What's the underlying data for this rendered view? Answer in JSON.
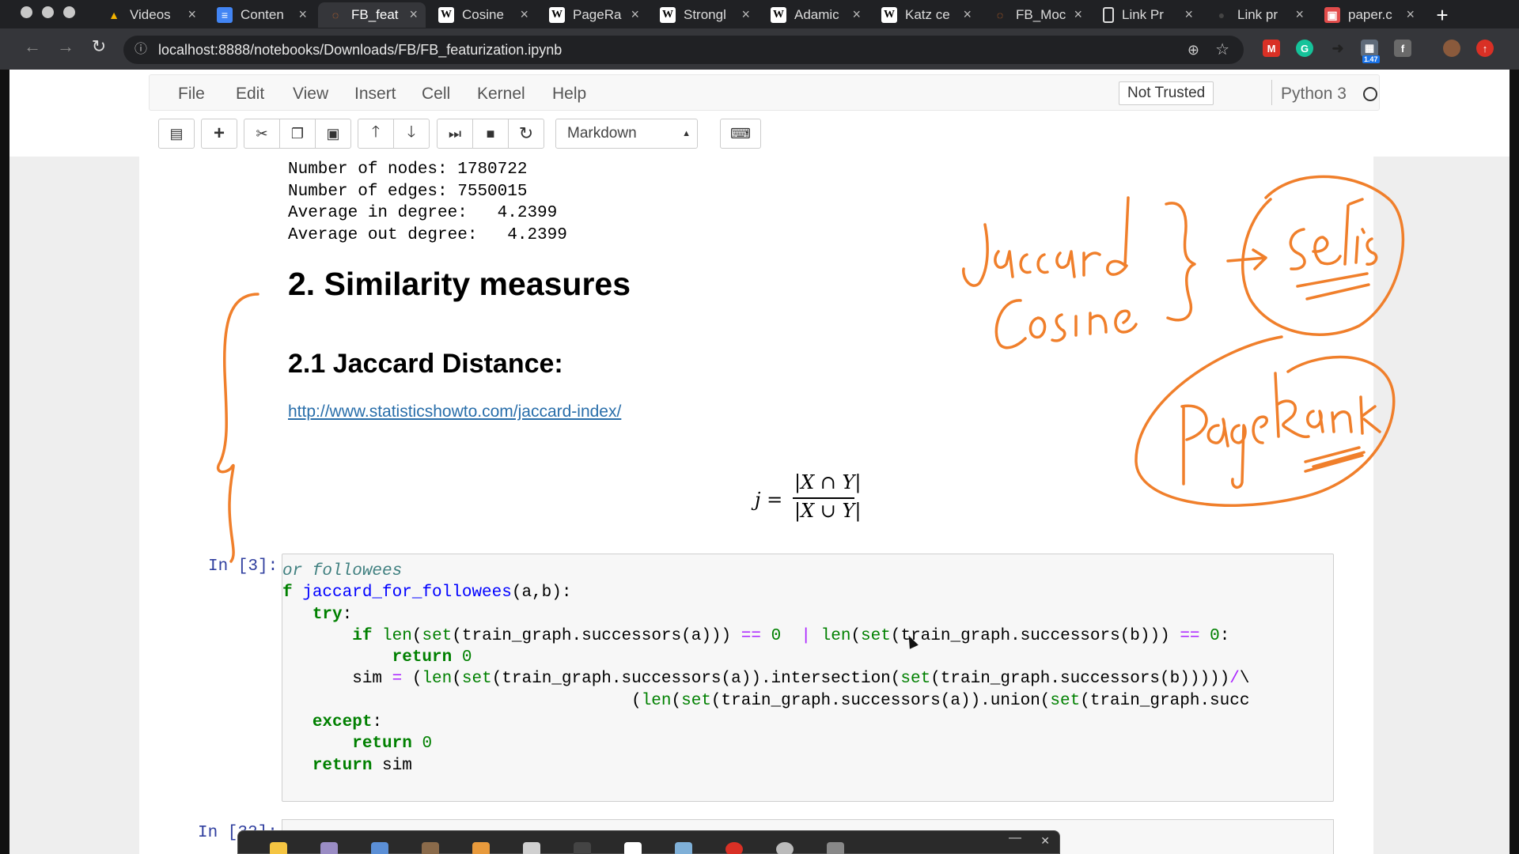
{
  "browser": {
    "tabs": [
      {
        "label": "Videos",
        "icon": "google-drive-icon",
        "color": "#f4b400"
      },
      {
        "label": "Conten",
        "icon": "google-docs-icon",
        "color": "#4285f4"
      },
      {
        "label": "FB_feat",
        "icon": "jupyter-icon",
        "color": "#f37626"
      },
      {
        "label": "Cosine",
        "icon": "wikipedia-icon",
        "color": "#ffffff"
      },
      {
        "label": "PageRa",
        "icon": "wikipedia-icon",
        "color": "#ffffff"
      },
      {
        "label": "Strongl",
        "icon": "wikipedia-icon",
        "color": "#ffffff"
      },
      {
        "label": "Adamic",
        "icon": "wikipedia-icon",
        "color": "#ffffff"
      },
      {
        "label": "Katz ce",
        "icon": "wikipedia-icon",
        "color": "#ffffff"
      },
      {
        "label": "FB_Moc",
        "icon": "jupyter-icon",
        "color": "#f37626"
      },
      {
        "label": "Link Pr",
        "icon": "file-icon",
        "color": "#ffffff"
      },
      {
        "label": "Link pr",
        "icon": "github-icon",
        "color": "#888888"
      },
      {
        "label": "paper.c",
        "icon": "pdf-icon",
        "color": "#e24c4b"
      }
    ],
    "active_tab": 2,
    "url": "localhost:8888/notebooks/Downloads/FB/FB_featurization.ipynb",
    "extension_badge": "1.47"
  },
  "notebook": {
    "menu": [
      "File",
      "Edit",
      "View",
      "Insert",
      "Cell",
      "Kernel",
      "Help"
    ],
    "trusted_label": "Not Trusted",
    "kernel_name": "Python 3",
    "cell_type": "Markdown",
    "output_lines": [
      "Number of nodes: 1780722",
      "Number of edges: 7550015",
      "Average in degree:   4.2399",
      "Average out degree:   4.2399"
    ],
    "heading_2": "2. Similarity measures",
    "heading_3": "2.1 Jaccard Distance:",
    "link": "http://www.statisticshowto.com/jaccard-index/",
    "formula": {
      "lhs": "j =",
      "numerator": "|X ∩ Y|",
      "denominator": "|X ∪ Y|"
    },
    "prompt_1": "In [3]:",
    "prompt_2": "In [32]:",
    "code_comment": "or followees"
  },
  "annotations": {
    "color": "#f07f2b",
    "words": [
      "Jaccard",
      "Cosine",
      "Sets",
      "PageRank"
    ]
  },
  "colors": {
    "link": "#296eaa",
    "prompt": "#303f9f",
    "keyword": "#008000",
    "function": "#0000ff"
  }
}
